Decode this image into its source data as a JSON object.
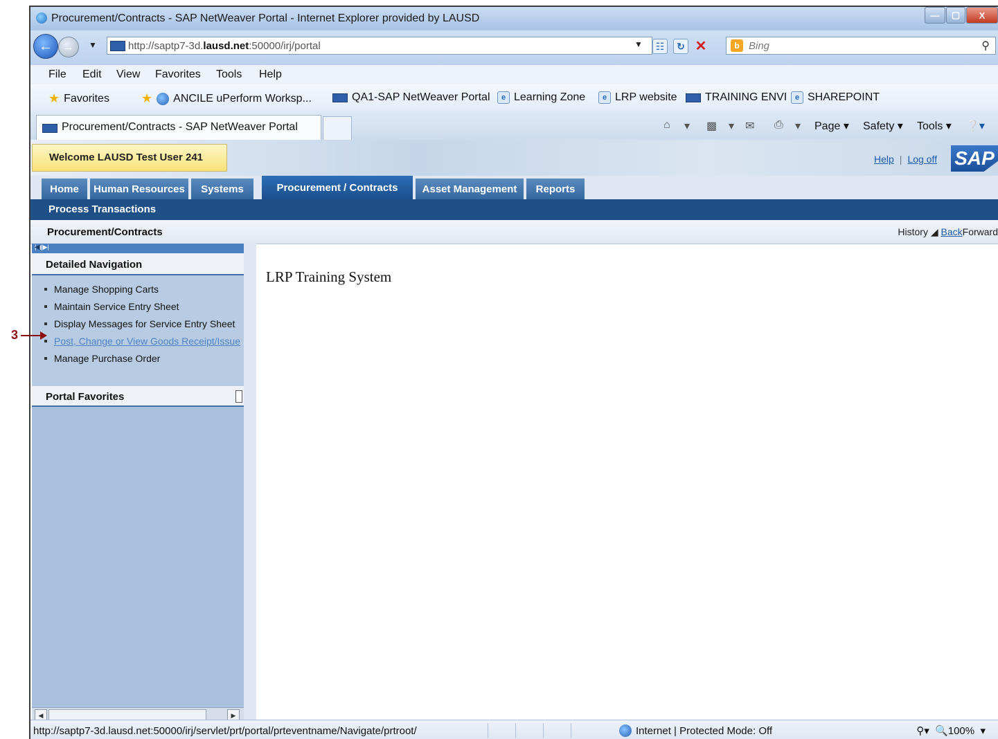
{
  "window": {
    "title": "Procurement/Contracts - SAP NetWeaver Portal - Internet Explorer provided by LAUSD",
    "minimize": "—",
    "maximize": "▢",
    "close": "X"
  },
  "address": {
    "url_prefix": "http://saptp7-3d.",
    "url_domain": "lausd.net",
    "url_suffix": ":50000/irj/portal",
    "search_placeholder": "Bing"
  },
  "menu": [
    "File",
    "Edit",
    "View",
    "Favorites",
    "Tools",
    "Help"
  ],
  "favorites": {
    "label": "Favorites",
    "items": [
      "ANCILE uPerform Worksp...",
      "QA1-SAP NetWeaver Portal",
      "Learning Zone",
      "LRP website",
      "TRAINING ENVI",
      "SHAREPOINT"
    ]
  },
  "tab": {
    "title": "Procurement/Contracts - SAP NetWeaver Portal"
  },
  "commands": [
    "Page ▾",
    "Safety ▾",
    "Tools ▾"
  ],
  "portal": {
    "welcome": "Welcome LAUSD Test User 241",
    "help": "Help",
    "logoff": "Log off",
    "logo": "SAP",
    "top_nav": [
      "Home",
      "Human Resources",
      "Systems",
      "Procurement / Contracts",
      "Asset Management",
      "Reports"
    ],
    "active_nav": "Procurement / Contracts",
    "sub_nav": "Process Transactions",
    "page_title": "Procurement/Contracts",
    "history": "History",
    "back": "Back",
    "forward": "Forward",
    "detailed_nav_title": "Detailed Navigation",
    "detailed_nav": [
      "Manage Shopping Carts",
      "Maintain Service Entry Sheet",
      "Display Messages for Service Entry Sheet",
      "Post, Change or View Goods Receipt/Issue",
      "Manage Purchase Order"
    ],
    "portal_favorites_title": "Portal Favorites",
    "content_text": "LRP Training System"
  },
  "callout": "3",
  "status": {
    "url": "http://saptp7-3d.lausd.net:50000/irj/servlet/prt/portal/prteventname/Navigate/prtroot/",
    "zone": "Internet | Protected Mode: Off",
    "zoom": "100%"
  },
  "colors": {
    "nav_blue": "#34679f",
    "nav_active": "#1b4e8c",
    "subnav": "#1e4f86",
    "welcome_yellow": "#f6e27a",
    "link_blue": "#1b5aa8",
    "callout_red": "#8b1010"
  }
}
